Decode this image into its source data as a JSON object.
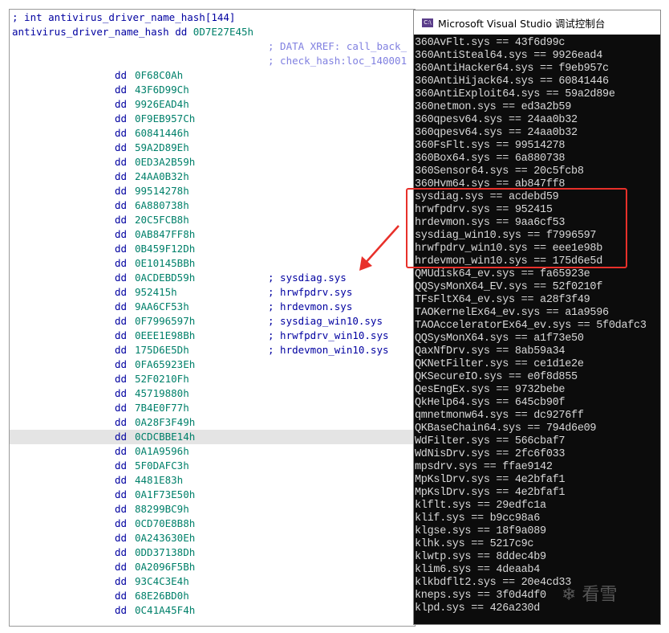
{
  "ida": {
    "header_comment": "; int antivirus_driver_name_hash[144]",
    "label": "antivirus_driver_name_hash",
    "first_directive": "dd",
    "first_value": "0D7E27E45h",
    "xref1": "; DATA XREF: call_back_",
    "xref2": "; check_hash:loc_140001",
    "directive": "dd",
    "rows": [
      {
        "v": "0F68C0Ah",
        "c": ""
      },
      {
        "v": "43F6D99Ch",
        "c": ""
      },
      {
        "v": "9926EAD4h",
        "c": ""
      },
      {
        "v": "0F9EB957Ch",
        "c": ""
      },
      {
        "v": "60841446h",
        "c": ""
      },
      {
        "v": "59A2D89Eh",
        "c": ""
      },
      {
        "v": "0ED3A2B59h",
        "c": ""
      },
      {
        "v": "24AA0B32h",
        "c": ""
      },
      {
        "v": "99514278h",
        "c": ""
      },
      {
        "v": "6A880738h",
        "c": ""
      },
      {
        "v": "20C5FCB8h",
        "c": ""
      },
      {
        "v": "0AB847FF8h",
        "c": ""
      },
      {
        "v": "0B459F12Dh",
        "c": ""
      },
      {
        "v": "0E10145BBh",
        "c": ""
      },
      {
        "v": "0ACDEBD59h",
        "c": "; sysdiag.sys"
      },
      {
        "v": "952415h",
        "c": "; hrwfpdrv.sys"
      },
      {
        "v": "9AA6CF53h",
        "c": "; hrdevmon.sys"
      },
      {
        "v": "0F7996597h",
        "c": "; sysdiag_win10.sys"
      },
      {
        "v": "0EEE1E98Bh",
        "c": "; hrwfpdrv_win10.sys"
      },
      {
        "v": "175D6E5Dh",
        "c": "; hrdevmon_win10.sys"
      },
      {
        "v": "0FA65923Eh",
        "c": ""
      },
      {
        "v": "52F0210Fh",
        "c": ""
      },
      {
        "v": "45719880h",
        "c": ""
      },
      {
        "v": "7B4E0F77h",
        "c": ""
      },
      {
        "v": "0A28F3F49h",
        "c": ""
      },
      {
        "v": "0CDCBBE14h",
        "c": ""
      },
      {
        "v": "0A1A9596h",
        "c": ""
      },
      {
        "v": "5F0DAFC3h",
        "c": ""
      },
      {
        "v": "4481E83h",
        "c": ""
      },
      {
        "v": "0A1F73E50h",
        "c": ""
      },
      {
        "v": "88299BC9h",
        "c": ""
      },
      {
        "v": "0CD70E8B8h",
        "c": ""
      },
      {
        "v": "0A243630Eh",
        "c": ""
      },
      {
        "v": "0DD37138Dh",
        "c": ""
      },
      {
        "v": "0A2096F5Bh",
        "c": ""
      },
      {
        "v": "93C4C3E4h",
        "c": ""
      },
      {
        "v": "68E26BD0h",
        "c": ""
      },
      {
        "v": "0C41A45F4h",
        "c": ""
      }
    ],
    "highlighted_row": 25
  },
  "console": {
    "title": "Microsoft Visual Studio 调试控制台",
    "icon_text": "C:\\",
    "lines": [
      "360AvFlt.sys == 43f6d99c",
      "360AntiSteal64.sys == 9926ead4",
      "360AntiHacker64.sys == f9eb957c",
      "360AntiHijack64.sys == 60841446",
      "360AntiExploit64.sys == 59a2d89e",
      "360netmon.sys == ed3a2b59",
      "360qpesv64.sys == 24aa0b32",
      "360qpesv64.sys == 24aa0b32",
      "360FsFlt.sys == 99514278",
      "360Box64.sys == 6a880738",
      "360Sensor64.sys == 20c5fcb8",
      "360Hvm64.sys == ab847ff8",
      "sysdiag.sys == acdebd59",
      "hrwfpdrv.sys == 952415",
      "hrdevmon.sys == 9aa6cf53",
      "sysdiag_win10.sys == f7996597",
      "hrwfpdrv_win10.sys == eee1e98b",
      "hrdevmon_win10.sys == 175d6e5d",
      "QMUdisk64_ev.sys == fa65923e",
      "QQSysMonX64_EV.sys == 52f0210f",
      "TFsFltX64_ev.sys == a28f3f49",
      "TAOKernelEx64_ev.sys == a1a9596",
      "TAOAcceleratorEx64_ev.sys == 5f0dafc3",
      "QQSysMonX64.sys == a1f73e50",
      "QaxNfDrv.sys == 8ab59a34",
      "QKNetFilter.sys == ce1d1e2e",
      "QKSecureIO.sys == e0f8d855",
      "QesEngEx.sys == 9732bebe",
      "QkHelp64.sys == 645cb90f",
      "qmnetmonw64.sys == dc9276ff",
      "QKBaseChain64.sys == 794d6e09",
      "WdFilter.sys == 566cbaf7",
      "WdNisDrv.sys == 2fc6f033",
      "mpsdrv.sys == ffae9142",
      "MpKslDrv.sys == 4e2bfaf1",
      "MpKslDrv.sys == 4e2bfaf1",
      "klflt.sys == 29edfc1a",
      "klif.sys == b9cc98a6",
      "klgse.sys == 18f9a089",
      "klhk.sys == 5217c9c",
      "klwtp.sys == 8ddec4b9",
      "klim6.sys == 4deaab4",
      "klkbdflt2.sys == 20e4cd33",
      "kneps.sys == 3f0d4df0",
      "klpd.sys == 426a230d"
    ]
  },
  "watermark": "看雪",
  "colors": {
    "highlight_box": "#e8302a"
  }
}
